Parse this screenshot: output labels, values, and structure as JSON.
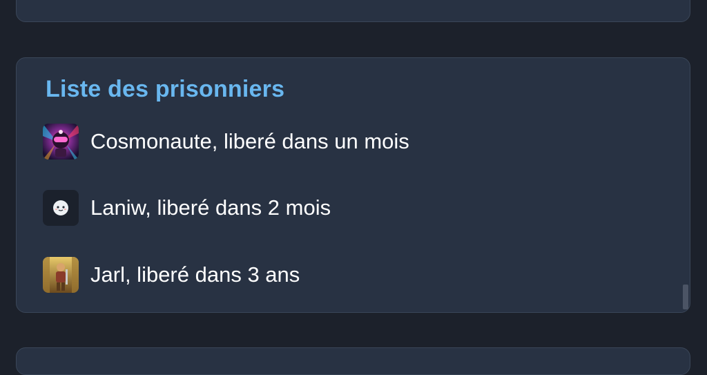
{
  "section": {
    "title": "Liste des prisonniers"
  },
  "prisoners": [
    {
      "text": "Cosmonaute, liberé dans un mois",
      "avatar": "cosmonaut-avatar"
    },
    {
      "text": "Laniw, liberé dans 2 mois",
      "avatar": "ghost-face-avatar"
    },
    {
      "text": "Jarl, liberé dans 3 ans",
      "avatar": "warrior-avatar"
    }
  ],
  "colors": {
    "background": "#1c212b",
    "card": "#283243",
    "title": "#69b7ef",
    "text": "#ffffff"
  }
}
